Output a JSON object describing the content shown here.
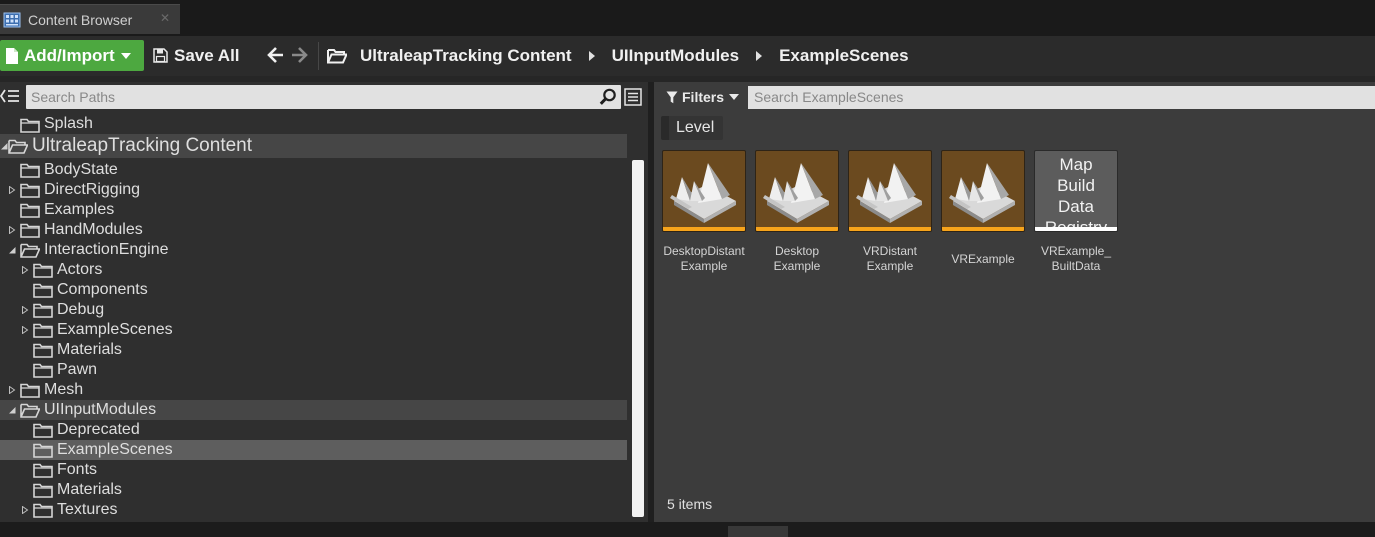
{
  "tab": {
    "title": "Content Browser",
    "close": "✕"
  },
  "toolbar": {
    "add_import": "Add/Import",
    "save_all": "Save All",
    "breadcrumbs": [
      "UltraleapTracking Content",
      "UIInputModules",
      "ExampleScenes"
    ]
  },
  "sources": {
    "search_placeholder": "Search Paths",
    "tree": [
      {
        "label": "Splash"
      },
      {
        "label": "UltraleapTracking Content"
      },
      {
        "label": "BodyState"
      },
      {
        "label": "DirectRigging"
      },
      {
        "label": "Examples"
      },
      {
        "label": "HandModules"
      },
      {
        "label": "InteractionEngine"
      },
      {
        "label": "Actors"
      },
      {
        "label": "Components"
      },
      {
        "label": "Debug"
      },
      {
        "label": "ExampleScenes"
      },
      {
        "label": "Materials"
      },
      {
        "label": "Pawn"
      },
      {
        "label": "Mesh"
      },
      {
        "label": "UIInputModules"
      },
      {
        "label": "Deprecated"
      },
      {
        "label": "ExampleScenes"
      },
      {
        "label": "Fonts"
      },
      {
        "label": "Materials"
      },
      {
        "label": "Textures"
      }
    ]
  },
  "assets": {
    "filters_label": "Filters",
    "search_placeholder": "Search ExampleScenes",
    "active_filter": "Level",
    "items": [
      {
        "name_line1": "DesktopDistant",
        "name_line2": "Example"
      },
      {
        "name_line1": "Desktop",
        "name_line2": "Example"
      },
      {
        "name_line1": "VRDistant",
        "name_line2": "Example"
      },
      {
        "name_line1": "VRExample",
        "name_line2": ""
      },
      {
        "name_line1": "VRExample_",
        "name_line2": "BuiltData",
        "thumb_text": [
          "Map",
          "Build",
          "Data",
          "Registry"
        ]
      }
    ],
    "count_label": "5 items"
  },
  "colors": {
    "add_button": "#4da840",
    "level_thumb": "#6b4a1f",
    "level_accent": "#f7a41b",
    "selection": "#5e5e5e"
  }
}
